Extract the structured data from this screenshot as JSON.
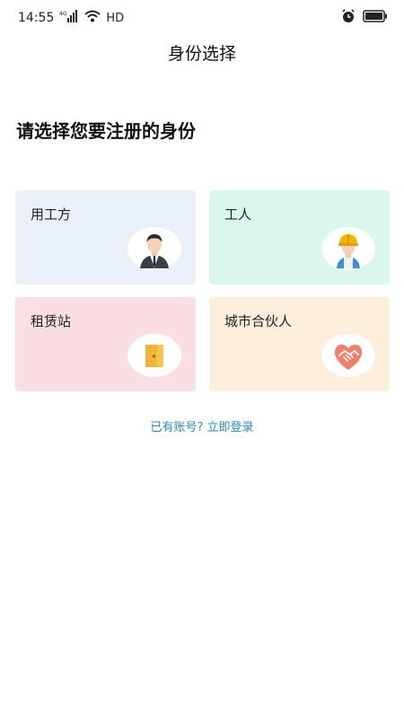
{
  "status_bar": {
    "time": "14:55",
    "network": "4G",
    "hd": "HD",
    "icons": [
      "signal-icon",
      "wifi-icon",
      "alarm-icon",
      "battery-icon"
    ]
  },
  "header": {
    "title": "身份选择"
  },
  "main": {
    "heading": "请选择您要注册的身份",
    "roles": [
      {
        "label": "用工方",
        "icon": "businessman-icon",
        "bg": "#E9F0F8"
      },
      {
        "label": "工人",
        "icon": "worker-icon",
        "bg": "#D9F7EC"
      },
      {
        "label": "租赁站",
        "icon": "door-icon",
        "bg": "#F9DFE3"
      },
      {
        "label": "城市合伙人",
        "icon": "handshake-icon",
        "bg": "#FDEEDC"
      }
    ],
    "login_link": "已有账号? 立即登录"
  },
  "colors": {
    "link": "#2a8bb5",
    "background": "#ffffff"
  }
}
